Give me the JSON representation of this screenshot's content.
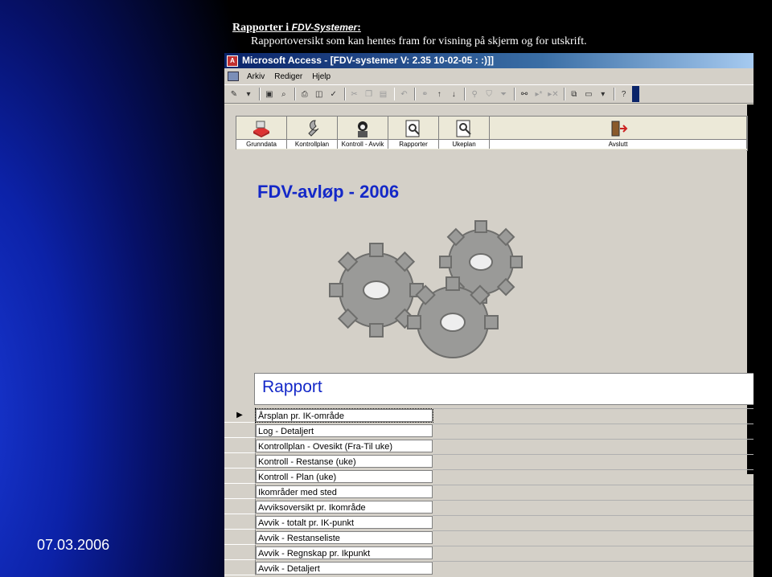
{
  "slide": {
    "title_prefix": "Rapporter i",
    "title_program": "FDV-Systemer",
    "title_colon": ":",
    "subtitle": "Rapportoversikt som kan hentes fram for visning på skjerm og for utskrift.",
    "date": "07.03.2006"
  },
  "window": {
    "title": "Microsoft Access - [FDV-systemer  V: 2.35 10-02-05 : :)]]"
  },
  "menubar": {
    "items": [
      "Arkiv",
      "Rediger",
      "Hjelp"
    ]
  },
  "navbar": {
    "buttons": [
      {
        "label": "Grunndata",
        "icon": "database-icon"
      },
      {
        "label": "Kontrollplan",
        "icon": "wrench-icon"
      },
      {
        "label": "Kontroll - Avvik",
        "icon": "person-icon"
      },
      {
        "label": "Rapporter",
        "icon": "report-preview-icon"
      },
      {
        "label": "Ukeplan",
        "icon": "magnifier-icon"
      },
      {
        "label": "Avslutt",
        "icon": "exit-door-icon"
      }
    ]
  },
  "banner": {
    "heading": "FDV-avløp - 2006"
  },
  "report_section": {
    "heading": "Rapport",
    "items": [
      "Årsplan pr. IK-område",
      "Log - Detaljert",
      "Kontrollplan - Ovesikt (Fra-Til uke)",
      "Kontroll - Restanse (uke)",
      "Kontroll - Plan (uke)",
      "Ikområder med sted",
      "Avviksoversikt pr. Ikområde",
      "Avvik - totalt pr. IK-punkt",
      "Avvik - Restanseliste",
      "Avvik - Regnskap pr. Ikpunkt",
      "Avvik - Detaljert"
    ],
    "selected_index": 0
  },
  "colors": {
    "heading_blue": "#1428c8",
    "window_gray": "#d4d0c8",
    "titlebar_blue": "#0a246a"
  }
}
